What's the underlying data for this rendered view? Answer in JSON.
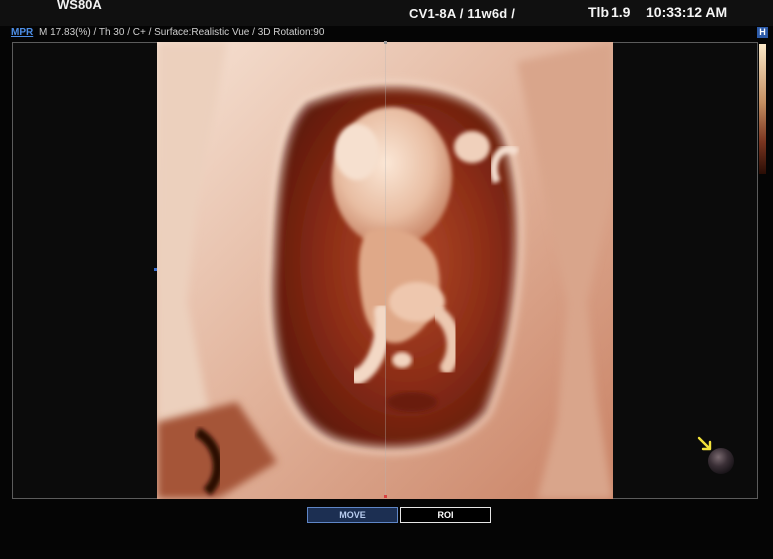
{
  "header": {
    "model": "WS80A",
    "probe_info": "CV1-8A / 11w6d /",
    "tib_label": "Tlb",
    "tib_value": "1.9",
    "time": "10:33:12 AM"
  },
  "info_line": {
    "mode": "MPR",
    "parameters": "M 17.83(%) / Th 30 / C+ / Surface:Realistic Vue / 3D Rotation:90",
    "badge": "H"
  },
  "controls": {
    "move_label": "MOVE",
    "roi_label": "ROI",
    "active": "MOVE"
  },
  "colors": {
    "accent": "#4d8ee6",
    "tissue_light": "#f1d6c4",
    "tissue_dark": "#8a2a16",
    "background": "#050505"
  },
  "icons": {
    "orientation_marker": "orientation-ball-icon",
    "pointer": "yellow-arrow-icon"
  }
}
